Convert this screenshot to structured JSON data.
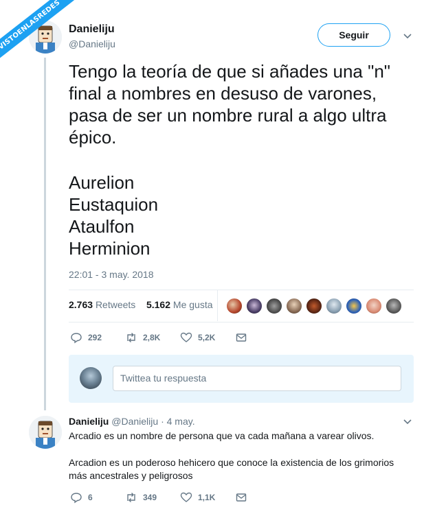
{
  "watermark": "VISTOENLASREDES",
  "tweet": {
    "author_name": "Danieliju",
    "author_handle": "@Danieliju",
    "follow_label": "Seguir",
    "text_lines": [
      "Tengo la teoría de que si añades una \"n\"",
      "final a nombres en desuso de varones,",
      "pasa de ser un nombre rural a algo ultra",
      "épico."
    ],
    "names": [
      "Aurelion",
      "Eustaquion",
      "Ataulfon",
      "Herminion"
    ],
    "timestamp": "22:01 - 3 may. 2018",
    "retweets_count": "2.763",
    "retweets_label": "Retweets",
    "likes_count": "5.162",
    "likes_label": "Me gusta",
    "actions": {
      "replies": "292",
      "retweets": "2,8K",
      "likes": "5,2K"
    }
  },
  "reply_box": {
    "placeholder": "Twittea tu respuesta"
  },
  "reply": {
    "author_name": "Danieliju",
    "author_handle": "@Danieliju",
    "date": "· 4 may.",
    "text_1": "Arcadio es un nombre de persona que va cada mañana a varear olivos.",
    "text_2_line1": "Arcadion es un poderoso hehicero que conoce la existencia de los grimorios",
    "text_2_line2": "más ancestrales y peligrosos",
    "actions": {
      "replies": "6",
      "retweets": "349",
      "likes": "1,1K"
    }
  },
  "colors": {
    "accent": "#1da1f2",
    "text": "#14171a",
    "muted": "#657786",
    "reply_bg": "#e8f5fd"
  }
}
